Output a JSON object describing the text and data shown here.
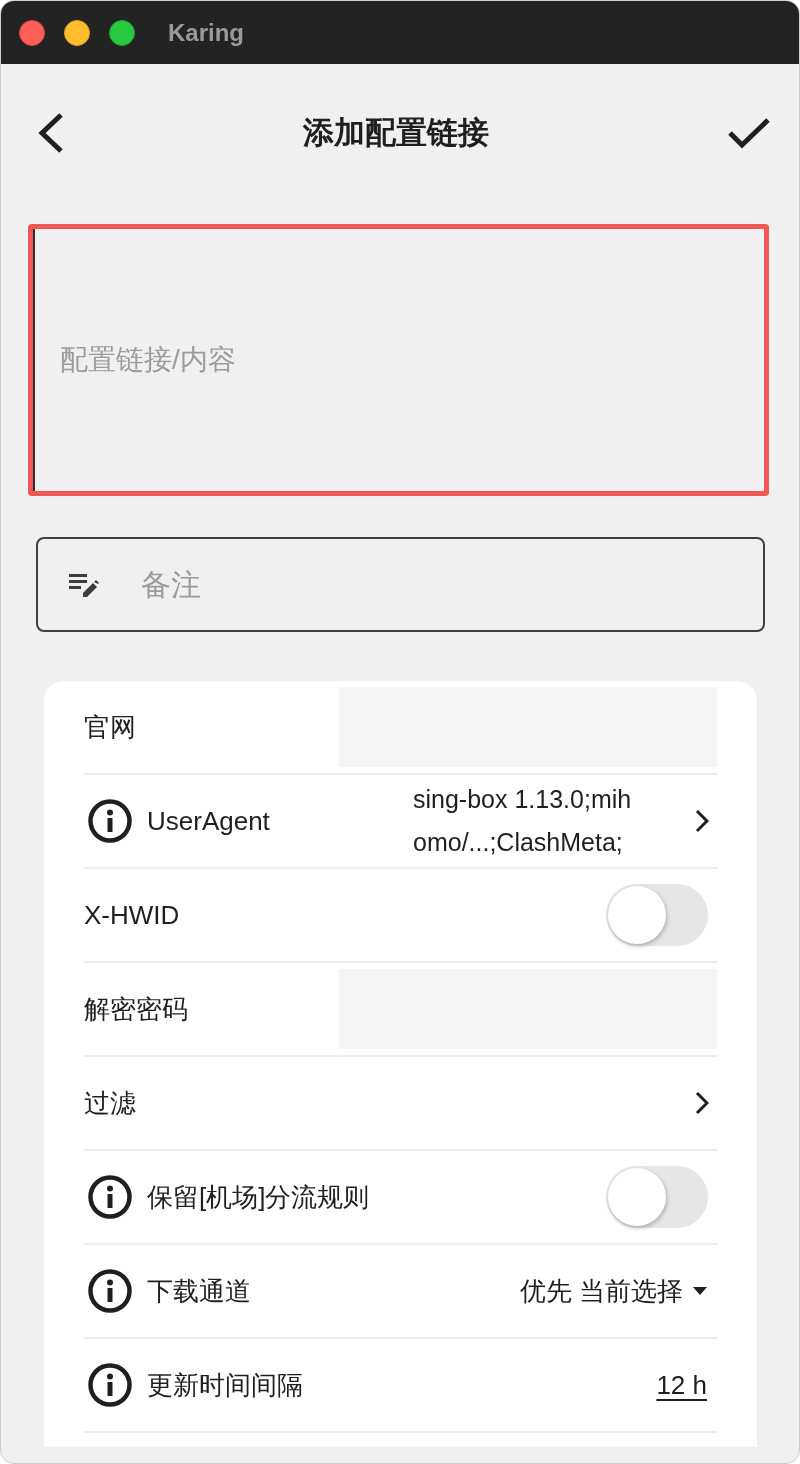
{
  "window": {
    "title": "Karing"
  },
  "app_bar": {
    "title": "添加配置链接"
  },
  "link_field": {
    "placeholder": "配置链接/内容"
  },
  "remark_field": {
    "placeholder": "备注"
  },
  "settings": [
    {
      "kind": "field",
      "label": "官网",
      "info": false
    },
    {
      "kind": "link",
      "label": "UserAgent",
      "info": true,
      "value_lines": [
        "sing-box 1.13.0;mih",
        "omo/...;ClashMeta;"
      ]
    },
    {
      "kind": "toggle",
      "label": "X-HWID",
      "info": false,
      "on": false
    },
    {
      "kind": "field",
      "label": "解密密码",
      "info": false
    },
    {
      "kind": "link",
      "label": "过滤",
      "info": false
    },
    {
      "kind": "toggle",
      "label": "保留[机场]分流规则",
      "info": true,
      "on": false
    },
    {
      "kind": "dropdown",
      "label": "下载通道",
      "info": true,
      "value": "优先 当前选择"
    },
    {
      "kind": "value",
      "label": "更新时间间隔",
      "info": true,
      "value": "12 h"
    }
  ]
}
